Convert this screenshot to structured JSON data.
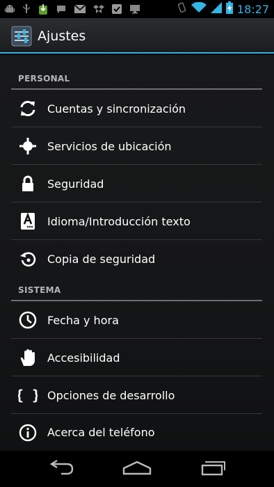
{
  "status_bar": {
    "time": "18:27",
    "notification_icons": [
      "android-debug-icon",
      "usb-icon",
      "download-icon",
      "message-icon",
      "gmail-icon",
      "dropbox-icon",
      "task-done-icon",
      "monitor-icon"
    ],
    "system_icons": [
      "vibrate-icon",
      "wifi-icon",
      "signal-icon",
      "battery-charging-icon"
    ],
    "accent_color": "#33b5e5"
  },
  "action_bar": {
    "title": "Ajustes",
    "icon": "settings-sliders-icon"
  },
  "sections": [
    {
      "header": "PERSONAL",
      "items": [
        {
          "label": "Cuentas y sincronización",
          "icon": "sync-icon"
        },
        {
          "label": "Servicios de ubicación",
          "icon": "location-icon"
        },
        {
          "label": "Seguridad",
          "icon": "lock-icon"
        },
        {
          "label": "Idioma/Introducción texto",
          "icon": "language-keyboard-icon"
        },
        {
          "label": "Copia de seguridad",
          "icon": "backup-restore-icon"
        }
      ]
    },
    {
      "header": "SISTEMA",
      "items": [
        {
          "label": "Fecha y hora",
          "icon": "clock-icon"
        },
        {
          "label": "Accesibilidad",
          "icon": "hand-icon"
        },
        {
          "label": "Opciones de desarrollo",
          "icon": "braces-icon"
        },
        {
          "label": "Acerca del teléfono",
          "icon": "info-icon"
        }
      ]
    }
  ],
  "nav_bar": {
    "buttons": [
      "back-icon",
      "home-icon",
      "recent-apps-icon"
    ]
  }
}
